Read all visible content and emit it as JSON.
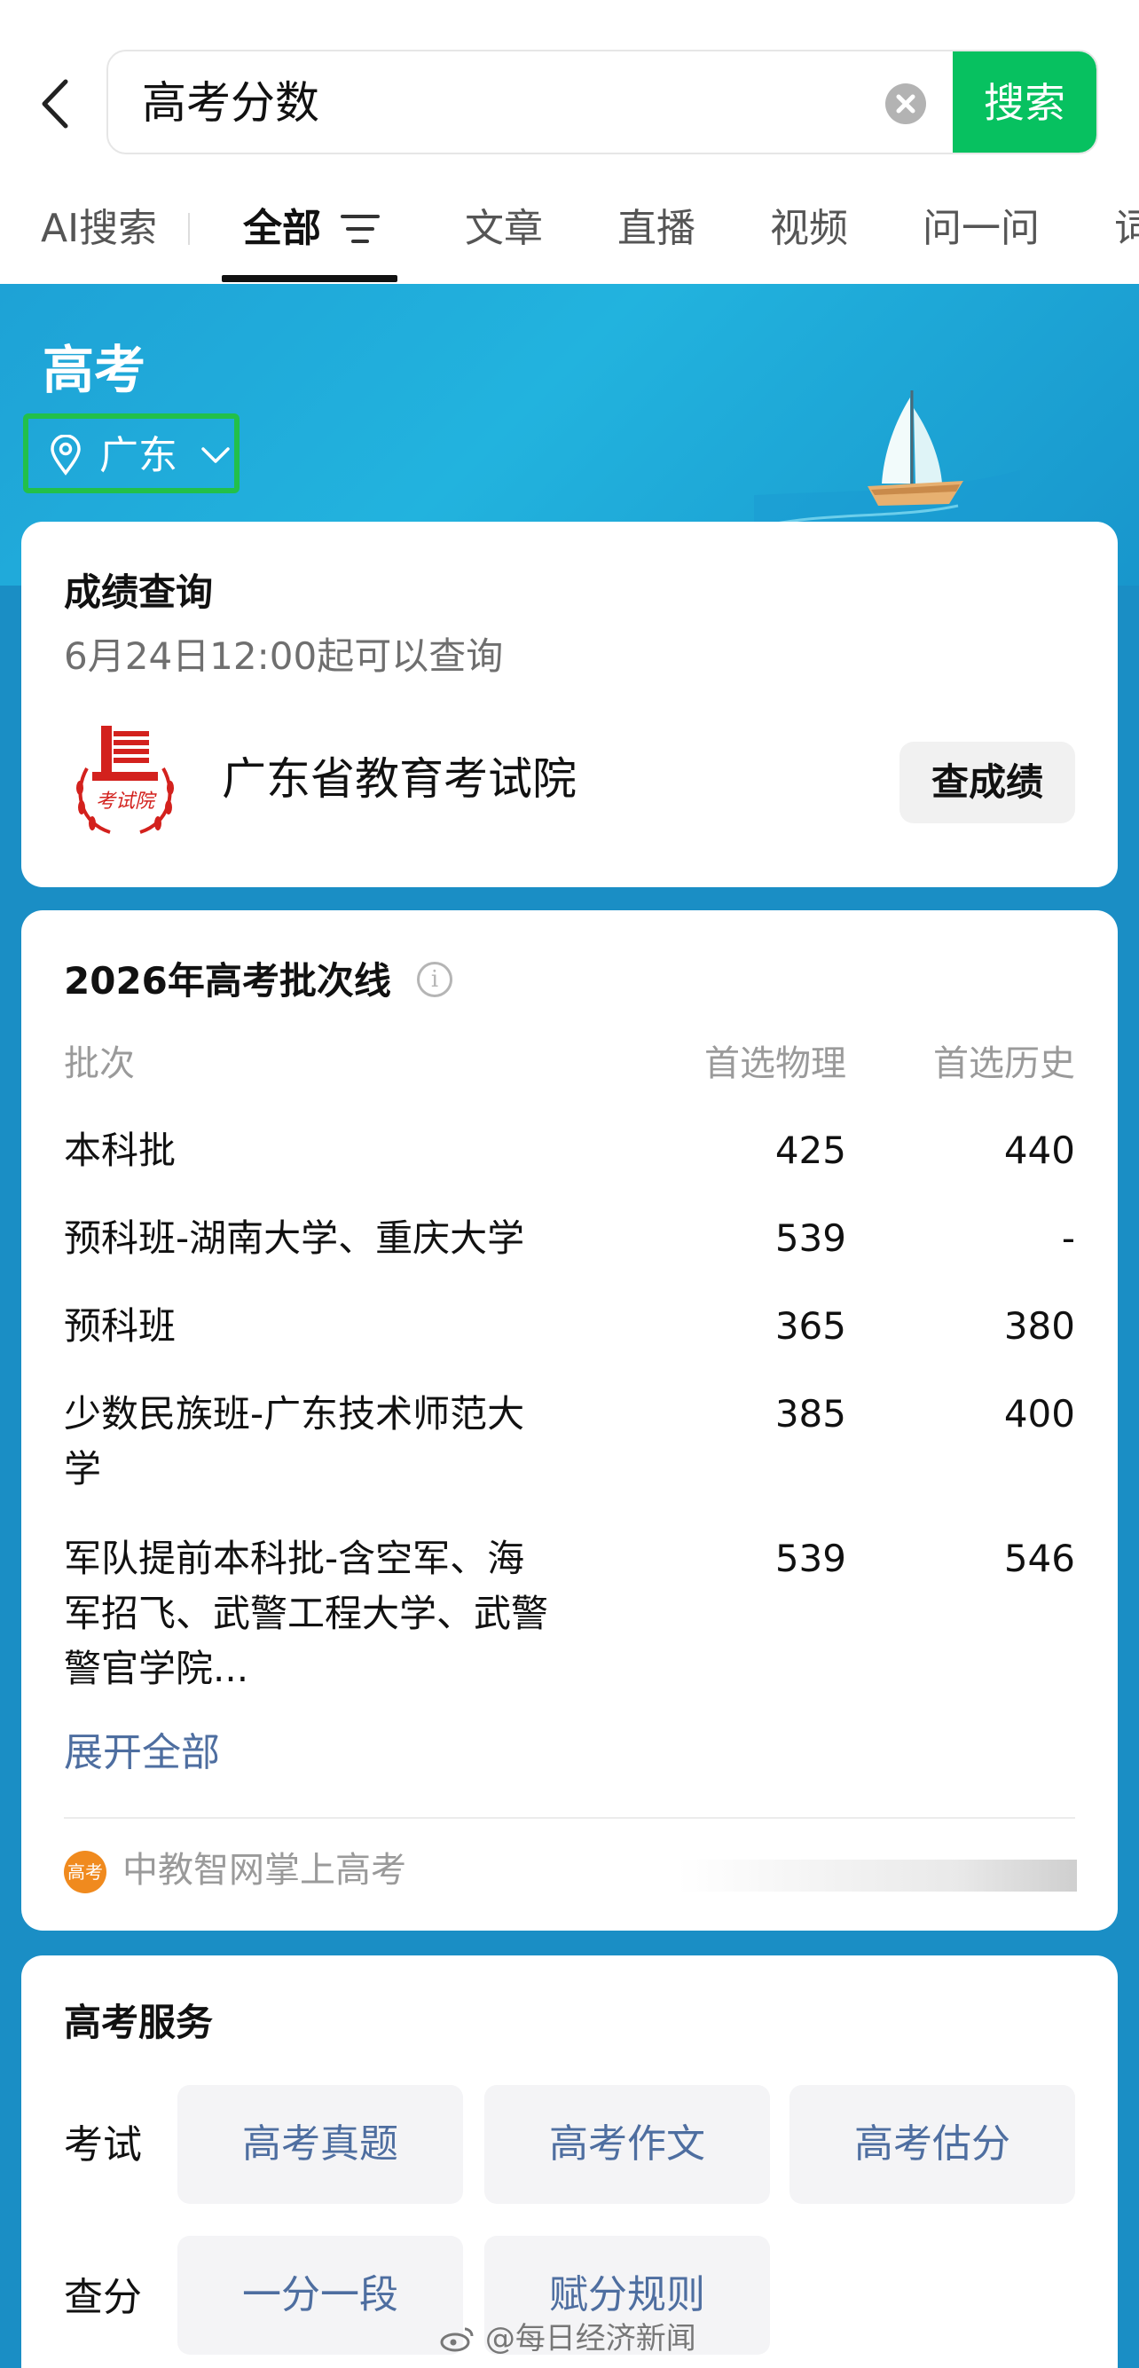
{
  "search": {
    "query": "高考分数",
    "button_label": "搜索"
  },
  "tabs": [
    {
      "label": "AI搜索"
    },
    {
      "label": "全部"
    },
    {
      "label": "文章"
    },
    {
      "label": "直播"
    },
    {
      "label": "视频"
    },
    {
      "label": "问一问"
    },
    {
      "label": "词"
    }
  ],
  "banner": {
    "title": "高考",
    "location": "广东"
  },
  "score_query": {
    "title": "成绩查询",
    "subtitle": "6月24日12:00起可以查询",
    "emblem_text": "考试院",
    "institution": "广东省教育考试院",
    "button_label": "查成绩"
  },
  "cutoff": {
    "title": "2026年高考批次线",
    "info_icon": "i",
    "headers": {
      "batch": "批次",
      "physics": "首选物理",
      "history": "首选历史"
    },
    "rows": [
      {
        "name": "本科批",
        "physics": "425",
        "history": "440"
      },
      {
        "name": "预科班-湖南大学、重庆大学",
        "physics": "539",
        "history": "-"
      },
      {
        "name": "预科班",
        "physics": "365",
        "history": "380"
      },
      {
        "name": "少数民族班-广东技术师范大学",
        "physics": "385",
        "history": "400"
      },
      {
        "name": "军队提前本科批-含空军、海军招飞、武警工程大学、武警警官学院...",
        "physics": "539",
        "history": "546"
      }
    ],
    "expand_label": "展开全部",
    "source_logo": "高考",
    "source": "中教智网掌上高考"
  },
  "services": {
    "title": "高考服务",
    "groups": [
      {
        "label": "考试",
        "items": [
          "高考真题",
          "高考作文",
          "高考估分"
        ]
      },
      {
        "label": "查分",
        "items": [
          "一分一段",
          "赋分规则"
        ]
      }
    ]
  },
  "watermark": "@每日经济新闻",
  "colors": {
    "accent": "#07c160",
    "banner": "#1a8ec5",
    "location_highlight": "#22c04a",
    "link": "#4e6ea0",
    "emblem": "#d3211d"
  },
  "icons": [
    "back-arrow-icon",
    "clear-icon",
    "filter-icon",
    "location-pin-icon",
    "chevron-down-icon",
    "info-icon",
    "weibo-icon"
  ]
}
